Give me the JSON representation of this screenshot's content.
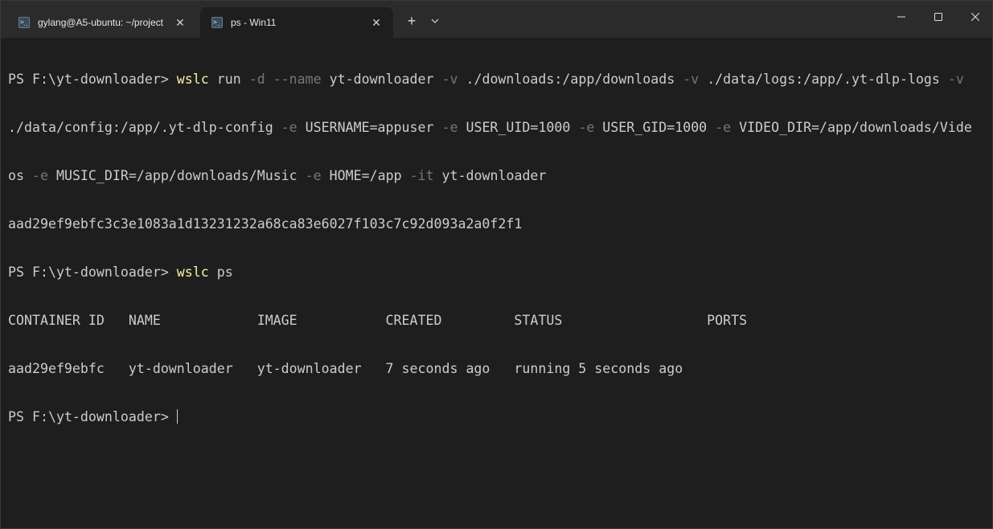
{
  "tabs": [
    {
      "label": "gylang@A5-ubuntu: ~/project",
      "active": false,
      "icon": "terminal-icon"
    },
    {
      "label": "ps - Win11",
      "active": true,
      "icon": "terminal-icon"
    }
  ],
  "tab_controls": {
    "new_tab": "+",
    "dropdown": "chevron-down-icon"
  },
  "window_controls": {
    "minimize": "─",
    "maximize": "☐",
    "close": "✕"
  },
  "terminal": {
    "prompt": "PS F:\\yt-downloader> ",
    "line1": {
      "cmd": "wslc",
      "t1": " run ",
      "p1": "-d --name",
      "t2": " yt-downloader ",
      "p2": "-v",
      "t3": " ./downloads:/app/downloads ",
      "p3": "-v",
      "t4": " ./data/logs:/app/.yt-dlp-logs ",
      "p4": "-v"
    },
    "line2": {
      "t1": "./data/config:/app/.yt-dlp-config ",
      "p1": "-e",
      "t2": " USERNAME=appuser ",
      "p2": "-e",
      "t3": " USER_UID=1000 ",
      "p3": "-e",
      "t4": " USER_GID=1000 ",
      "p4": "-e",
      "t5": " VIDEO_DIR=/app/downloads/Vide"
    },
    "line3": {
      "t1": "os ",
      "p1": "-e",
      "t2": " MUSIC_DIR=/app/downloads/Music ",
      "p2": "-e",
      "t3": " HOME=/app ",
      "p3": "-it",
      "t4": " yt-downloader"
    },
    "container_hash": "aad29ef9ebfc3c3e1083a1d13231232a68ca83e6027f103c7c92d093a2a0f2f1",
    "line5": {
      "cmd": "wslc",
      "t1": " ps"
    },
    "table_header": "CONTAINER ID   NAME            IMAGE           CREATED         STATUS                  PORTS",
    "table_row": "aad29ef9ebfc   yt-downloader   yt-downloader   7 seconds ago   running 5 seconds ago"
  }
}
